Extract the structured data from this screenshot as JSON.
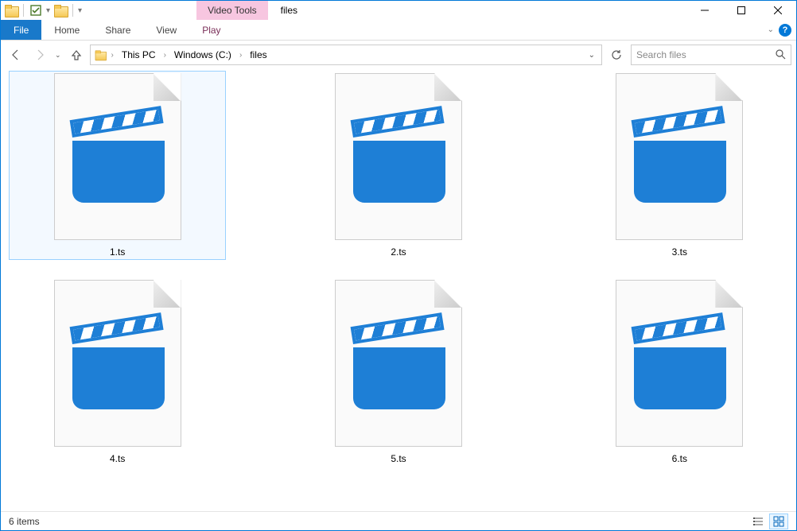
{
  "window": {
    "title": "files",
    "context_group": "Video Tools"
  },
  "ribbon": {
    "file": "File",
    "tabs": [
      "Home",
      "Share",
      "View"
    ],
    "context_tab": "Play"
  },
  "breadcrumbs": [
    "This PC",
    "Windows (C:)",
    "files"
  ],
  "search": {
    "placeholder": "Search files"
  },
  "files": [
    {
      "name": "1.ts",
      "selected": true
    },
    {
      "name": "2.ts",
      "selected": false
    },
    {
      "name": "3.ts",
      "selected": false
    },
    {
      "name": "4.ts",
      "selected": false
    },
    {
      "name": "5.ts",
      "selected": false
    },
    {
      "name": "6.ts",
      "selected": false
    }
  ],
  "status": {
    "count_label": "6 items"
  }
}
